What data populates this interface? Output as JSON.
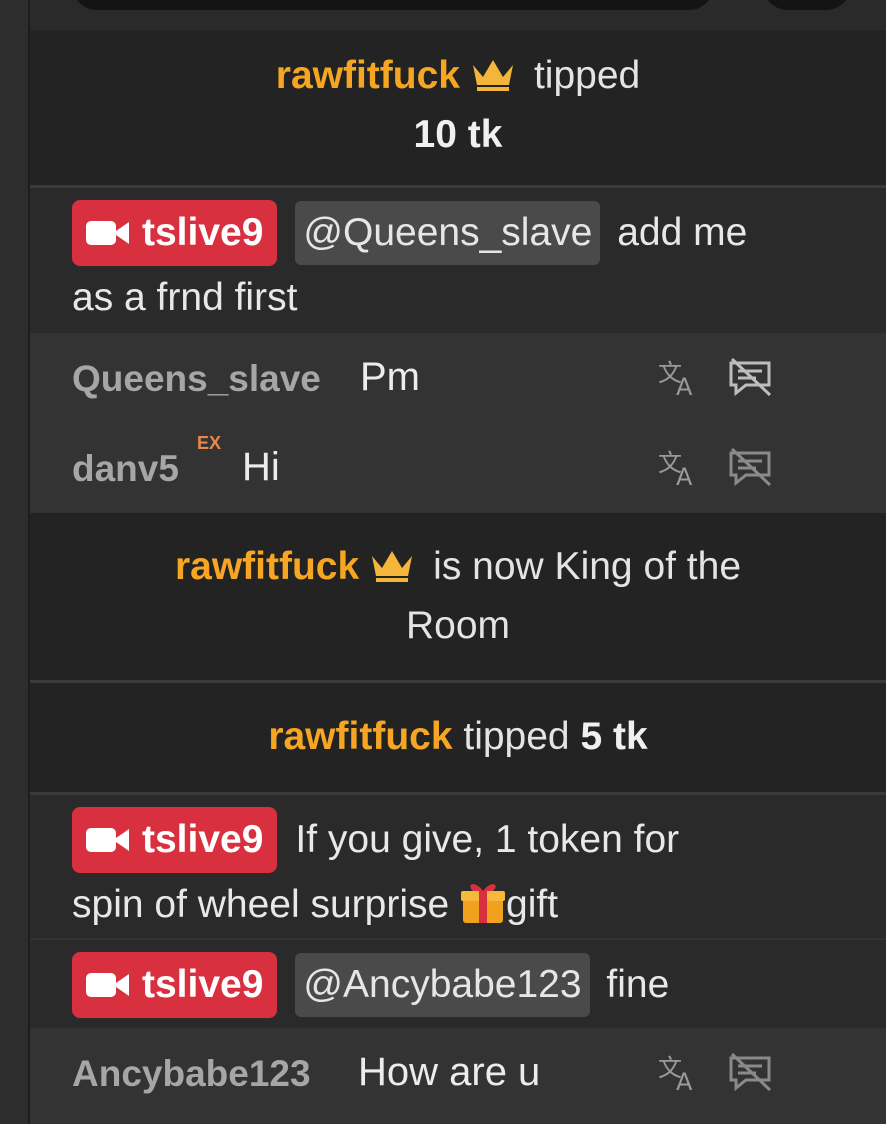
{
  "colors": {
    "accent_name": "#f6a623",
    "host_badge": "#d9303f",
    "mention_bg": "#4a4a4a"
  },
  "icons": {
    "crown": "crown-icon",
    "camera": "video-camera-icon",
    "translate": "translate-icon",
    "hide": "hide-message-icon",
    "gift": "gift-icon"
  },
  "events": {
    "tip1": {
      "name": "rawfitfuck",
      "verb": "tipped",
      "amount": "10 tk"
    },
    "king": {
      "name": "rawfitfuck",
      "text_line1": "is now King of the",
      "text_line2": "Room"
    },
    "tip2": {
      "name": "rawfitfuck",
      "verb": "tipped",
      "amount": "5 tk"
    }
  },
  "host": {
    "m1": {
      "badge": "tslive9",
      "mention": "@Queens_slave",
      "text_a": "add me",
      "text_b": "as a frnd first"
    },
    "m2": {
      "badge": "tslive9",
      "text_a": "If you give, 1 token for",
      "text_b": "spin of wheel surprise ",
      "text_c": "gift"
    },
    "m3": {
      "badge": "tslive9",
      "mention": "@Ancybabe123",
      "text_a": "fine"
    }
  },
  "users": {
    "u1": {
      "name": "Queens_slave",
      "message": "Pm"
    },
    "u2": {
      "name": "danv5",
      "badge": "EX",
      "message": "Hi"
    },
    "u3": {
      "name": "Ancybabe123",
      "message": "How are u"
    }
  }
}
